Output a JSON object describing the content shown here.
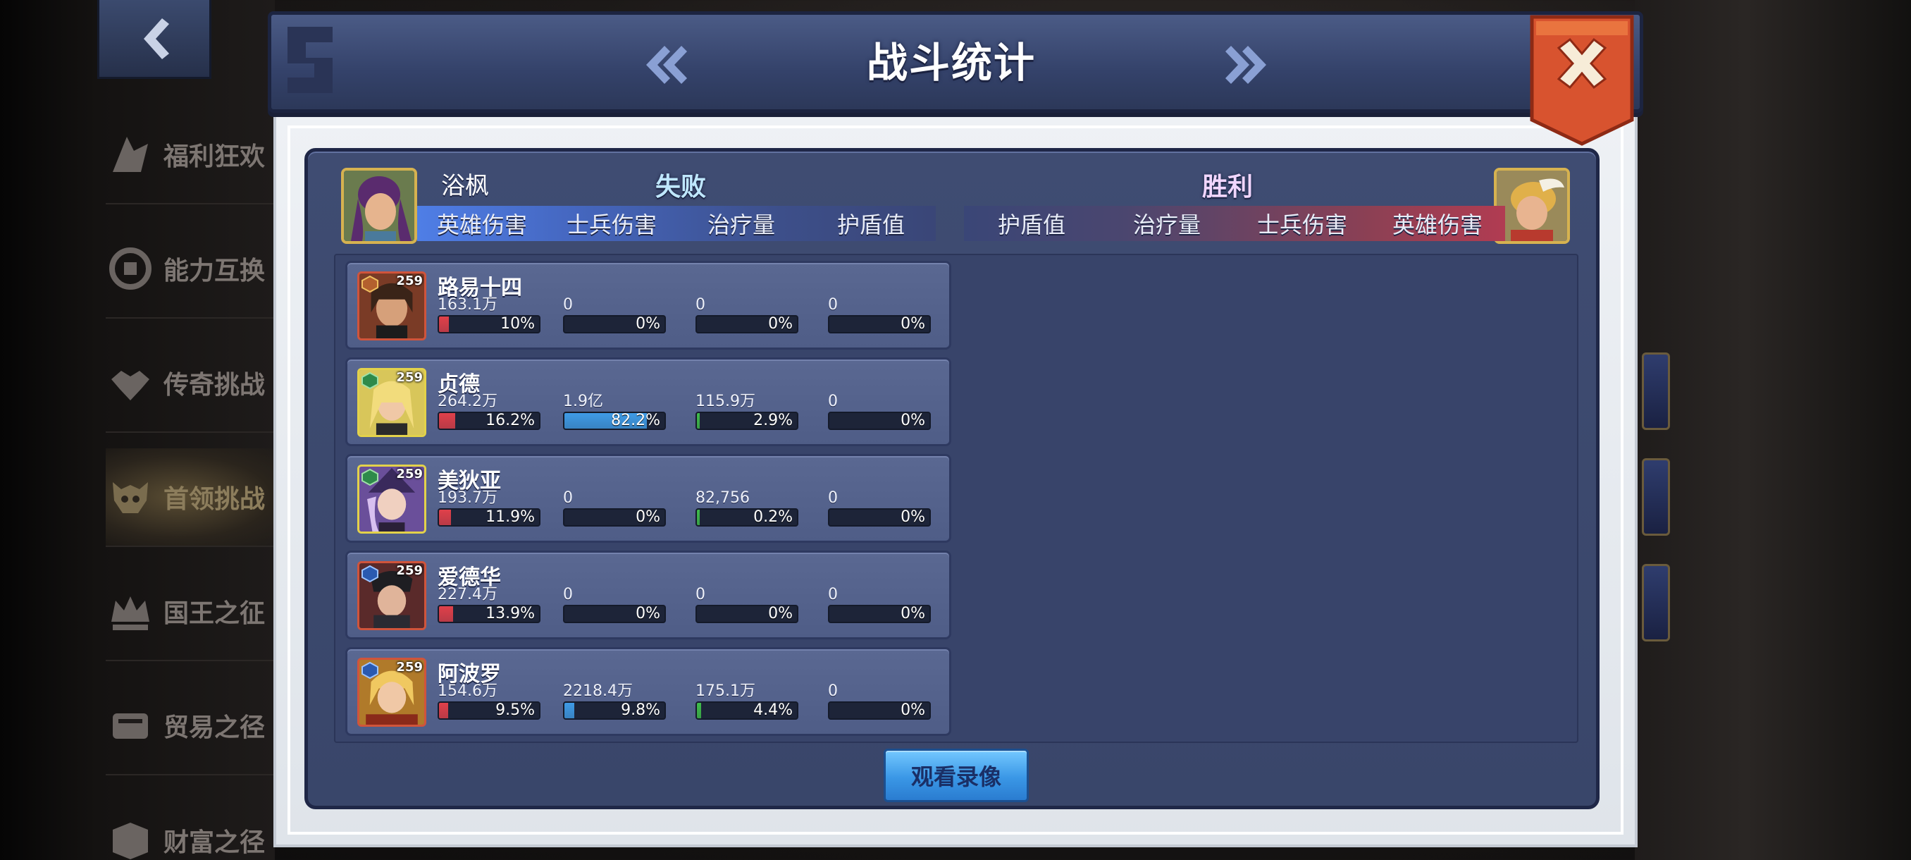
{
  "dialog": {
    "title": "战斗统计",
    "close_icon": "close-icon",
    "prev_icon": "double-chevron-left-icon",
    "next_icon": "double-chevron-right-icon"
  },
  "sidebar": {
    "items": [
      {
        "label": "福利狂欢",
        "icon": "gift-icon"
      },
      {
        "label": "能力互换",
        "icon": "swap-icon"
      },
      {
        "label": "传奇挑战",
        "icon": "helmet-icon"
      },
      {
        "label": "首领挑战",
        "icon": "skull-icon"
      },
      {
        "label": "国王之征",
        "icon": "crown-icon"
      },
      {
        "label": "贸易之径",
        "icon": "trade-icon"
      },
      {
        "label": "财富之径",
        "icon": "treasure-icon"
      }
    ]
  },
  "left_team": {
    "player_name": "浴枫",
    "result": "失败",
    "tabs": [
      "英雄伤害",
      "士兵伤害",
      "治疗量",
      "护盾值"
    ]
  },
  "right_team": {
    "result": "胜利",
    "tabs": [
      "护盾值",
      "治疗量",
      "士兵伤害",
      "英雄伤害"
    ]
  },
  "colors": {
    "hero_damage": "#e0404a",
    "soldier_damage": "#3f9be6",
    "healing": "#3fbd4a",
    "shield": "#8a93b0"
  },
  "heroes": [
    {
      "name": "路易十四",
      "level": "259",
      "stats": [
        {
          "value": "163.1万",
          "pct": "10%",
          "fill": 0.1
        },
        {
          "value": "0",
          "pct": "0%",
          "fill": 0
        },
        {
          "value": "0",
          "pct": "0%",
          "fill": 0
        },
        {
          "value": "0",
          "pct": "0%",
          "fill": 0
        }
      ]
    },
    {
      "name": "贞德",
      "level": "259",
      "stats": [
        {
          "value": "264.2万",
          "pct": "16.2%",
          "fill": 0.162
        },
        {
          "value": "1.9亿",
          "pct": "82.2%",
          "fill": 0.822
        },
        {
          "value": "115.9万",
          "pct": "2.9%",
          "fill": 0.029
        },
        {
          "value": "0",
          "pct": "0%",
          "fill": 0
        }
      ]
    },
    {
      "name": "美狄亚",
      "level": "259",
      "stats": [
        {
          "value": "193.7万",
          "pct": "11.9%",
          "fill": 0.119
        },
        {
          "value": "0",
          "pct": "0%",
          "fill": 0
        },
        {
          "value": "82,756",
          "pct": "0.2%",
          "fill": 0.002
        },
        {
          "value": "0",
          "pct": "0%",
          "fill": 0
        }
      ]
    },
    {
      "name": "爱德华",
      "level": "259",
      "stats": [
        {
          "value": "227.4万",
          "pct": "13.9%",
          "fill": 0.139
        },
        {
          "value": "0",
          "pct": "0%",
          "fill": 0
        },
        {
          "value": "0",
          "pct": "0%",
          "fill": 0
        },
        {
          "value": "0",
          "pct": "0%",
          "fill": 0
        }
      ]
    },
    {
      "name": "阿波罗",
      "level": "259",
      "stats": [
        {
          "value": "154.6万",
          "pct": "9.5%",
          "fill": 0.095
        },
        {
          "value": "2218.4万",
          "pct": "9.8%",
          "fill": 0.098
        },
        {
          "value": "175.1万",
          "pct": "4.4%",
          "fill": 0.044
        },
        {
          "value": "0",
          "pct": "0%",
          "fill": 0
        }
      ]
    }
  ],
  "actions": {
    "watch_replay": "观看录像"
  }
}
